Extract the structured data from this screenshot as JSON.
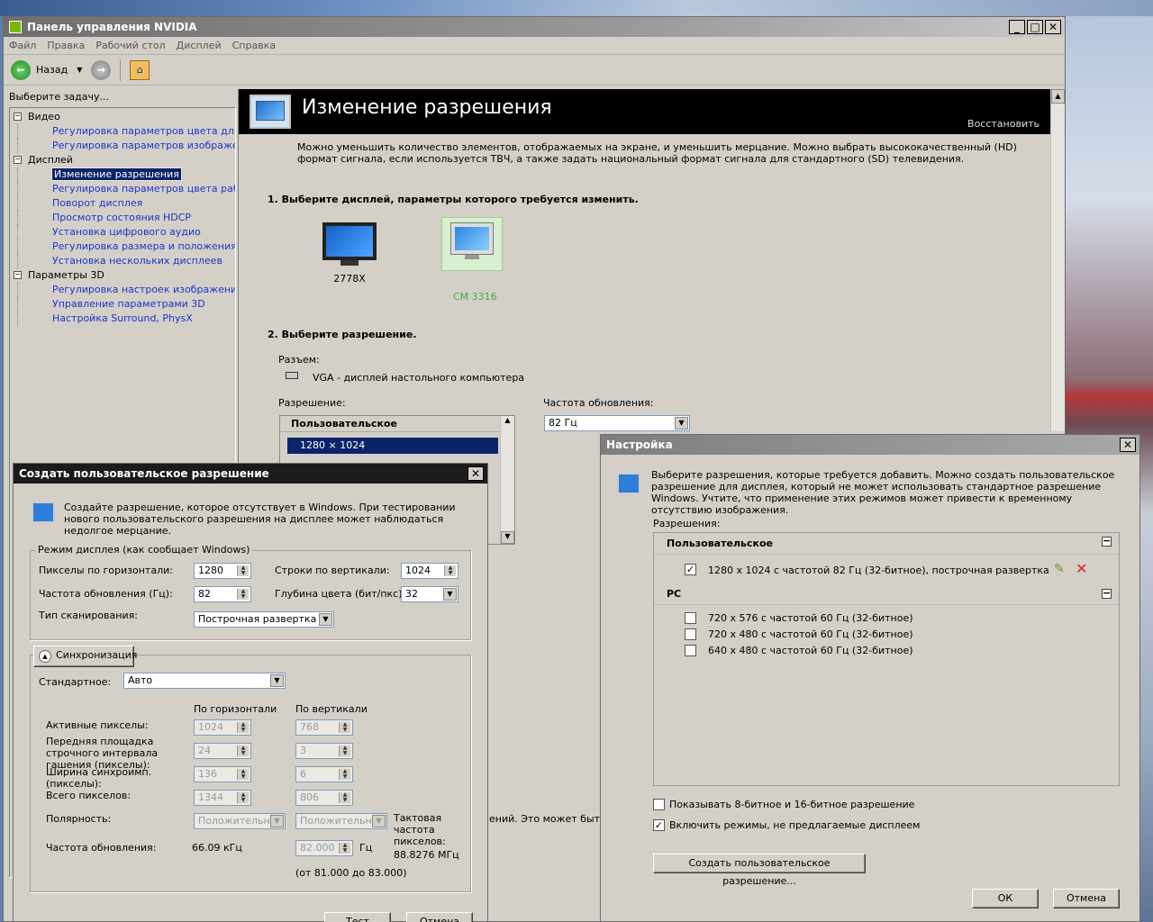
{
  "main_window": {
    "title": "Панель управления NVIDIA",
    "menu": [
      "Файл",
      "Правка",
      "Рабочий стол",
      "Дисплей",
      "Справка"
    ],
    "toolbar": {
      "back": "Назад"
    },
    "task_prompt": "Выберите задачу...",
    "tree": [
      {
        "label": "Видео",
        "items": [
          "Регулировка параметров цвета для вид",
          "Регулировка параметров изображения д"
        ]
      },
      {
        "label": "Дисплей",
        "items": [
          "Изменение разрешения",
          "Регулировка параметров цвета рабочег",
          "Поворот дисплея",
          "Просмотр состояния HDCP",
          "Установка цифрового аудио",
          "Регулировка размера и положения рабо",
          "Установка нескольких дисплеев"
        ]
      },
      {
        "label": "Параметры 3D",
        "items": [
          "Регулировка настроек изображения с пр",
          "Управление параметрами 3D",
          "Настройка Surround, PhysX"
        ]
      }
    ],
    "header_title": "Изменение разрешения",
    "restore": "Восстановить",
    "description": "Можно уменьшить количество элементов, отображаемых на экране, и уменьшить мерцание. Можно выбрать высококачественный (HD) формат сигнала, если используется ТВЧ, а также задать национальный формат сигнала для стандартного (SD) телевидения.",
    "step1": "1. Выберите дисплей, параметры которого требуется изменить.",
    "displays": [
      "2778X",
      "CM 3316"
    ],
    "step2": "2. Выберите разрешение.",
    "connector_label": "Разъем:",
    "connector_value": "VGA - дисплей настольного компьютера",
    "resolution_label": "Разрешение:",
    "refresh_label": "Частота обновления:",
    "res_list_header": "Пользовательское",
    "res_selected": "1280 × 1024",
    "refresh_value": "82 Гц",
    "partial_text": "ений. Это может быть в"
  },
  "custom_dialog": {
    "title": "Создать пользовательское разрешение",
    "intro": "Создайте разрешение, которое отсутствует в Windows. При тестировании нового пользовательского разрешения на дисплее может наблюдаться недолгое мерцание.",
    "mode_group": "Режим дисплея (как сообщает Windows)",
    "h_pixels_label": "Пикселы по горизонтали:",
    "h_pixels": "1280",
    "v_lines_label": "Строки по вертикали:",
    "v_lines": "1024",
    "refresh_label": "Частота обновления (Гц):",
    "refresh": "82",
    "depth_label": "Глубина цвета (бит/пкс):",
    "depth": "32",
    "scan_label": "Тип сканирования:",
    "scan": "Построчная развертка",
    "sync_button": "Синхронизация",
    "standard_label": "Стандартное:",
    "standard": "Авто",
    "col_h": "По горизонтали",
    "col_v": "По вертикали",
    "rows": [
      {
        "label": "Активные пикселы:",
        "h": "1024",
        "v": "768"
      },
      {
        "label": "Передняя площадка строчного интервала гашения (пикселы):",
        "h": "24",
        "v": "3"
      },
      {
        "label": "Ширина синхроимп. (пикселы):",
        "h": "136",
        "v": "6"
      },
      {
        "label": "Всего пикселов:",
        "h": "1344",
        "v": "806"
      }
    ],
    "polarity_label": "Полярность:",
    "polarity_h": "Положительная",
    "polarity_v": "Положительная",
    "pixel_clock_label": "Тактовая частота пикселов:",
    "pixel_clock": "88.8276 МГц",
    "freq_label": "Частота обновления:",
    "freq_h": "66.09 кГц",
    "freq_v": "82.000",
    "freq_unit": "Гц",
    "range": "(от 81.000 до 83.000)",
    "test": "Тест",
    "cancel": "Отмена"
  },
  "settings_dialog": {
    "title": "Настройка",
    "intro": "Выберите разрешения, которые требуется добавить. Можно создать пользовательское разрешение для дисплея, который не может использовать стандартное разрешение Windows. Учтите, что применение этих режимов может привести к временному отсутствию изображения.",
    "resolutions_label": "Разрешения:",
    "custom_header": "Пользовательское",
    "custom_item": "1280 x 1024 с частотой 82 Гц (32-битное), построчная развертка",
    "pc_header": "PC",
    "pc_items": [
      "720 x 576 с частотой 60 Гц (32-битное)",
      "720 x 480 с частотой 60 Гц (32-битное)",
      "640 x 480 с частотой 60 Гц (32-битное)"
    ],
    "opt1": "Показывать 8-битное и 16-битное разрешение",
    "opt2": "Включить режимы, не предлагаемые дисплеем",
    "create_button": "Создать пользовательское разрешение...",
    "ok": "ОК",
    "cancel": "Отмена"
  },
  "colors": {
    "link": "#1a36c8",
    "selected": "#0a246a",
    "green_label": "#3cb043"
  }
}
